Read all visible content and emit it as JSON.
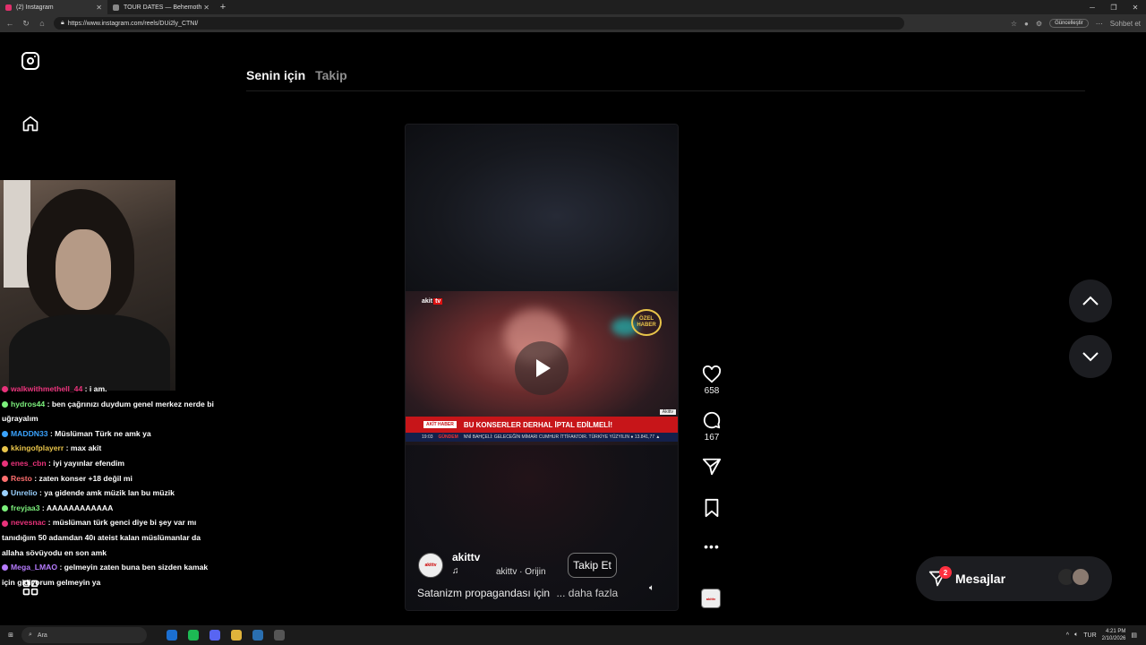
{
  "browser": {
    "tabs": [
      {
        "label": "(2) Instagram",
        "color": "#e1306c"
      },
      {
        "label": "TOUR DATES — Behemoth",
        "color": "#888888"
      }
    ],
    "url": "https://www.instagram.com/reels/DUi2ly_CTNI/",
    "update_label": "Güncelleştir",
    "chat_label": "Sohbet et"
  },
  "feed_tabs": {
    "active": "Senin için",
    "inactive": "Takip"
  },
  "chat": [
    {
      "user": "walkwithmethell_44",
      "text": ": i am.",
      "color": "#e8327a"
    },
    {
      "user": "hydros44",
      "text": ": ben çağrınızı duydum genel merkez nerde bi uğrayalım",
      "color": "#7cf07c"
    },
    {
      "user": "MADDN33",
      "text": ": Müslüman Türk ne amk ya",
      "color": "#3aa3ff"
    },
    {
      "user": "kkingofplayerr",
      "text": ": max akit",
      "color": "#e8c44a"
    },
    {
      "user": "enes_cbn",
      "text": ": iyi yayınlar efendim",
      "color": "#e8327a"
    },
    {
      "user": "Resto",
      "text": ": zaten konser +18 değil mi",
      "color": "#ff6f6f"
    },
    {
      "user": "Unrelio",
      "text": ": ya gidende amk müzik lan bu müzik",
      "color": "#9ad1ff"
    },
    {
      "user": "freyjaa3",
      "text": ": AAAAAAAAAAAA",
      "color": "#7cf07c"
    },
    {
      "user": "nevesnac",
      "text": ": müslüman türk genci diye bi şey var mı tanıdığım 50 adamdan 40ı ateist kalan müslümanlar da allaha sövüyodu en son amk",
      "color": "#e8327a"
    },
    {
      "user": "Mega_LMAO",
      "text": ": gelmeyin zaten buna ben sizden kamak için gidiyorum gelmeyin ya",
      "color": "#b77cff"
    }
  ],
  "reel": {
    "channel_logo": "akit",
    "channel_logo_tv": "tv",
    "badge": "ÖZEL HABER",
    "headline_tag": "AKİT HABER",
    "headline": "BU KONSERLER DERHAL İPTAL EDİLMELİ!",
    "akittv_small": "Akittv",
    "ticker_time": "19:03",
    "ticker_label": "GÜNDEM",
    "ticker_text": "NNİ BAHÇELİ: GELECEĞİN MİMARI CUMHUR İTTİFAKI'DIR. TÜRKİYE YÜZYILIN ● 13.841,77 ▲",
    "author": "akittv",
    "avatar_text": "akittv",
    "audio": "akittv · Orijin",
    "follow_label": "Takip Et",
    "caption": "Satanizm propagandası için",
    "more_label": "... daha fazla"
  },
  "actions": {
    "likes": "658",
    "comments": "167"
  },
  "messages": {
    "label": "Mesajlar",
    "badge": "2"
  },
  "taskbar": {
    "search": "Ara",
    "lang": "TUR",
    "time": "4:21 PM",
    "date": "2/10/2026"
  }
}
